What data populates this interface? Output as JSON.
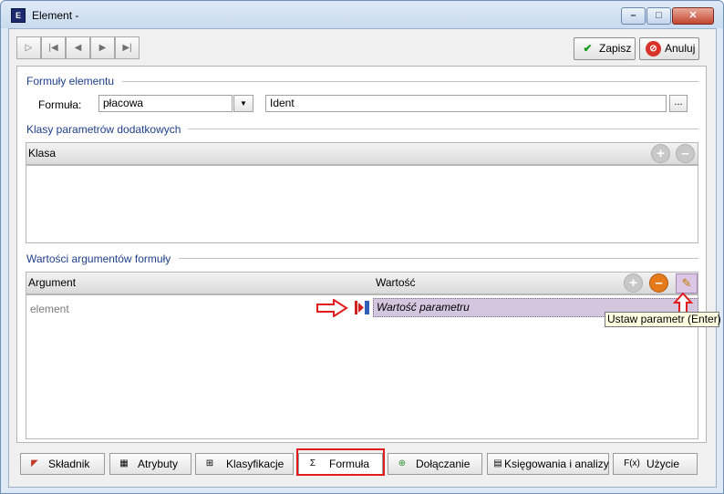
{
  "window": {
    "title": "Element -",
    "icon": "app-icon",
    "controls": {
      "minimize": "–",
      "maximize": "□",
      "close": "✕"
    }
  },
  "nav": {
    "first": "first-record-icon",
    "prev": "previous-record-icon",
    "next": "next-record-icon",
    "last": "last-record-icon",
    "new": "new-record-icon"
  },
  "actions": {
    "save_label": "Zapisz",
    "cancel_label": "Anuluj"
  },
  "formula_section": {
    "title": "Formuły elementu",
    "formula_label": "Formuła:",
    "formula_value": "płacowa",
    "ident_value": "Ident",
    "ellipsis": "..."
  },
  "classes_section": {
    "title": "Klasy parametrów dodatkowych",
    "column_klasa": "Klasa"
  },
  "args_section": {
    "title": "Wartości argumentów formuły",
    "column_argument": "Argument",
    "column_value": "Wartość",
    "rows": [
      {
        "argument": "element",
        "value": "Wartość parametru"
      }
    ],
    "tooltip": "Ustaw parametr (Enter)"
  },
  "tabs": [
    {
      "label": "Składnik",
      "icon": "component-icon"
    },
    {
      "label": "Atrybuty",
      "icon": "attributes-icon"
    },
    {
      "label": "Klasyfikacje",
      "icon": "classification-icon"
    },
    {
      "label": "Formuła",
      "icon": "formula-icon",
      "active": true
    },
    {
      "label": "Dołączanie",
      "icon": "attachment-icon"
    },
    {
      "label": "Księgowania i analizy",
      "icon": "accounting-icon"
    },
    {
      "label": "Użycie",
      "icon": "usage-icon"
    }
  ],
  "colors": {
    "section_title": "#1f3f8a",
    "highlight": "#e21c1c",
    "selected_cell": "#d3c6de",
    "tooltip_bg": "#ffffe1"
  }
}
